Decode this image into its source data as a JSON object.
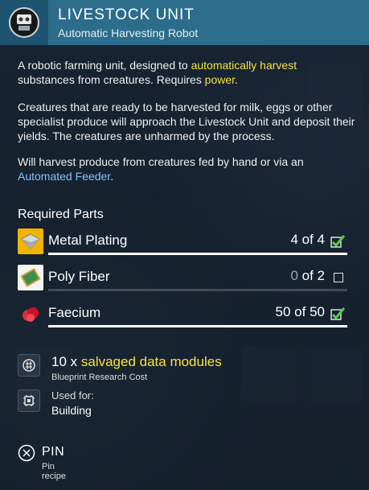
{
  "header": {
    "title": "LIVESTOCK UNIT",
    "subtitle": "Automatic Harvesting Robot",
    "icon": "robot-unit-icon",
    "color": "#2d6d8c"
  },
  "description": {
    "p1_a": "A robotic farming unit, designed to ",
    "p1_hl": "automatically harvest",
    "p1_b": " substances from creatures. Requires ",
    "p1_hl2": "power",
    "p1_c": ".",
    "p2": "Creatures that are ready to be harvested for milk, eggs or other specialist produce will approach the Livestock Unit and deposit their yields. The creatures are unharmed by the process.",
    "p3_a": "Will harvest produce from creatures fed by hand or via an ",
    "p3_link": "Automated Feeder",
    "p3_b": "."
  },
  "required_parts": {
    "title": "Required Parts",
    "items": [
      {
        "name": "Metal Plating",
        "have": "4",
        "sep": " of ",
        "need": "4",
        "complete": true,
        "icon": "metal-plating-icon"
      },
      {
        "name": "Poly Fiber",
        "have": "0",
        "sep": " of ",
        "need": "2",
        "complete": false,
        "icon": "poly-fiber-icon"
      },
      {
        "name": "Faecium",
        "have": "50",
        "sep": " of ",
        "need": "50",
        "complete": true,
        "icon": "faecium-icon"
      }
    ]
  },
  "research": {
    "prefix": "10 x ",
    "highlight": "salvaged data modules",
    "sub": "Blueprint Research Cost",
    "icon": "data-module-icon"
  },
  "used_for": {
    "label": "Used for:",
    "value": "Building",
    "icon": "building-chip-icon"
  },
  "pin": {
    "label": "PIN",
    "sub": "Pin recipe",
    "icon": "pin-close-icon"
  },
  "colors": {
    "highlight_yellow": "#f4e23c",
    "link_blue": "#7ec2ff",
    "check_green": "#4fd14b"
  }
}
